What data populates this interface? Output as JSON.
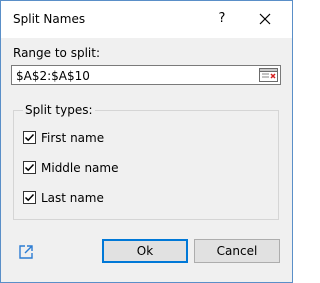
{
  "dialog": {
    "title": "Split Names",
    "help_label": "?",
    "close_icon": "close-icon"
  },
  "range": {
    "label": "Range to split:",
    "value": "$A$2:$A$10",
    "picker_icon": "range-select-icon"
  },
  "split_types": {
    "legend": "Split types:",
    "items": [
      {
        "label": "First name",
        "checked": true
      },
      {
        "label": "Middle name",
        "checked": true
      },
      {
        "label": "Last name",
        "checked": true
      }
    ]
  },
  "footer": {
    "link_icon": "external-link-icon",
    "ok_label": "Ok",
    "cancel_label": "Cancel"
  },
  "colors": {
    "accent": "#0078d7",
    "window_border": "#5a8fc8"
  }
}
